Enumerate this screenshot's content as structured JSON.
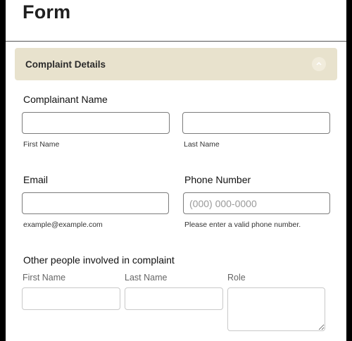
{
  "header": {
    "title": "Form"
  },
  "section": {
    "title": "Complaint Details",
    "collapse_icon": "chevron-up-icon"
  },
  "complainant": {
    "label": "Complainant Name",
    "first_sublabel": "First Name",
    "last_sublabel": "Last Name",
    "first_value": "",
    "last_value": ""
  },
  "email": {
    "label": "Email",
    "sublabel": "example@example.com",
    "value": ""
  },
  "phone": {
    "label": "Phone Number",
    "placeholder": "(000) 000-0000",
    "sublabel": "Please enter a valid phone number."
  },
  "others": {
    "label": "Other people involved in complaint",
    "columns": [
      "First Name",
      "Last Name",
      "Role"
    ]
  }
}
